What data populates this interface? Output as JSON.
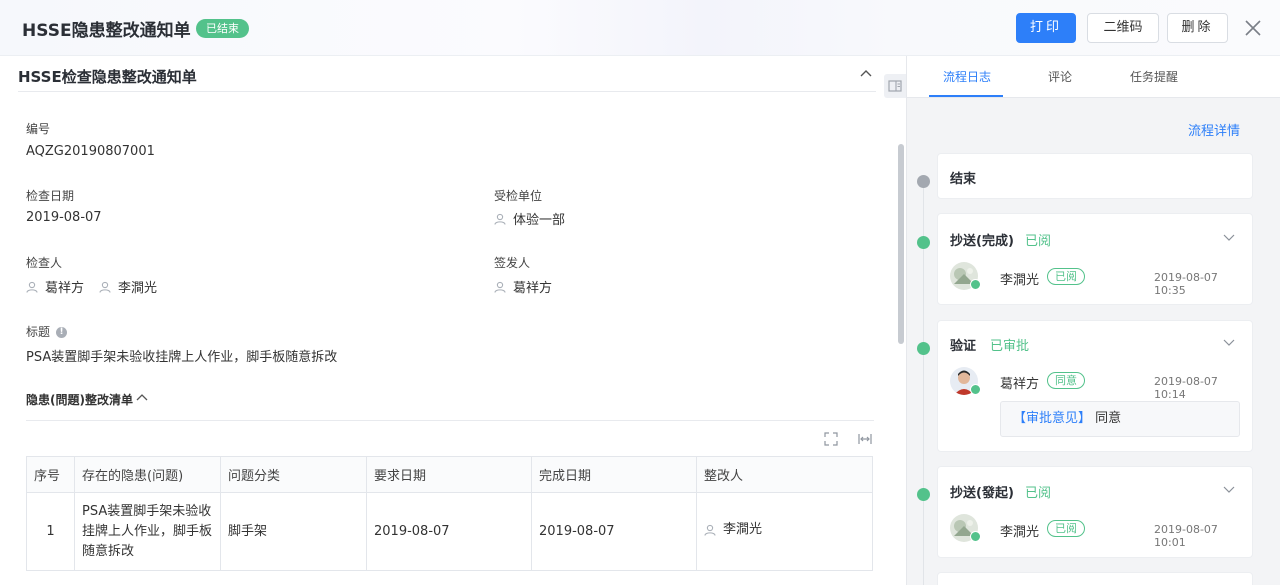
{
  "header": {
    "title": "HSSE隐患整改通知单",
    "status_badge": "已结束",
    "print_label": "打印",
    "qr_label": "二维码",
    "delete_label": "删除"
  },
  "form": {
    "section_title": "HSSE检查隐患整改通知单",
    "number_label": "编号",
    "number_value": "AQZG20190807001",
    "check_date_label": "检查日期",
    "check_date_value": "2019-08-07",
    "inspected_unit_label": "受检单位",
    "inspected_unit_value": "体验一部",
    "inspector_label": "检查人",
    "inspectors": [
      "葛祥方",
      "李澗光"
    ],
    "issuer_label": "签发人",
    "issuer_value": "葛祥方",
    "subject_label": "标题",
    "subject_value": "PSA装置脚手架未验收挂牌上人作业，脚手板随意拆改",
    "list_title": "隐患(問題)整改清单"
  },
  "table": {
    "headers": [
      "序号",
      "存在的隐患(问题)",
      "问题分类",
      "要求日期",
      "完成日期",
      "整改人"
    ],
    "rows": [
      {
        "idx": "1",
        "issue": "PSA装置脚手架未验收挂牌上人作业，脚手板随意拆改",
        "category": "脚手架",
        "required_date": "2019-08-07",
        "completed_date": "2019-08-07",
        "rectifier": "李澗光"
      }
    ]
  },
  "sidebar": {
    "tabs": [
      "流程日志",
      "评论",
      "任务提醒"
    ],
    "flow_detail_label": "流程详情",
    "end_node": "结束",
    "nodes": [
      {
        "title": "抄送(完成)",
        "status": "已阅",
        "person": "李澗光",
        "tag": "已阅",
        "time": "2019-08-07 10:35"
      },
      {
        "title": "验证",
        "status": "已审批",
        "person": "葛祥方",
        "tag": "同意",
        "time": "2019-08-07 10:14",
        "opinion_key": "【审批意见】",
        "opinion_value": "同意"
      },
      {
        "title": "抄送(發起)",
        "status": "已阅",
        "person": "李澗光",
        "tag": "已阅",
        "time": "2019-08-07 10:01"
      }
    ]
  },
  "colors": {
    "primary": "#2d7ff9",
    "success": "#53c28b"
  }
}
